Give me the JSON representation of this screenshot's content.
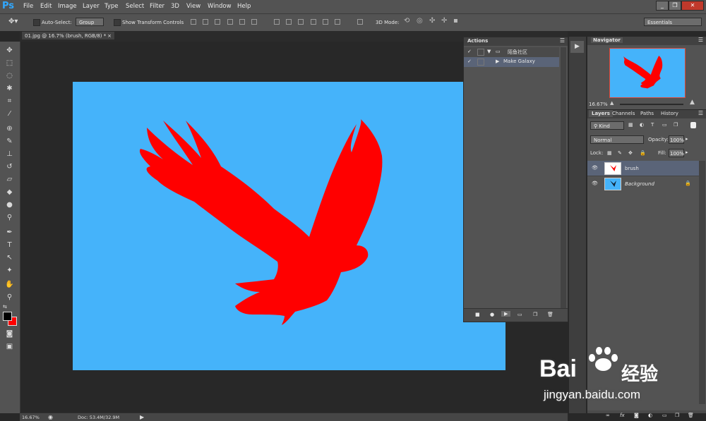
{
  "app": {
    "logo": "Ps"
  },
  "menu": [
    "File",
    "Edit",
    "Image",
    "Layer",
    "Type",
    "Select",
    "Filter",
    "3D",
    "View",
    "Window",
    "Help"
  ],
  "window_buttons": [
    "_",
    "❐",
    "✕"
  ],
  "options": {
    "auto_select_label": "Auto-Select:",
    "auto_select_value": "Group",
    "transform_label": "Show Transform Controls",
    "mode3d_label": "3D Mode:",
    "workspace": "Essentials"
  },
  "document": {
    "tab_title": "01.jpg @ 16.7% (brush, RGB/8) *",
    "tab_close": "×"
  },
  "status": {
    "zoom": "16.67%",
    "doc": "Doc: 53.4M/32.9M"
  },
  "actions_panel": {
    "title": "Actions",
    "items": [
      {
        "label": "陌鱼社区",
        "type": "set"
      },
      {
        "label": "Make Galaxy",
        "type": "action"
      }
    ]
  },
  "navigator": {
    "title": "Navigator",
    "zoom": "16.67%"
  },
  "layers_panel": {
    "tabs": [
      "Layers",
      "Channels",
      "Paths",
      "History"
    ],
    "filter": "Kind",
    "blend_mode": "Normal",
    "opacity_label": "Opacity:",
    "opacity": "100%",
    "lock_label": "Lock:",
    "fill_label": "Fill:",
    "fill": "100%",
    "layers": [
      {
        "name": "brush",
        "selected": true
      },
      {
        "name": "Background",
        "selected": false,
        "locked": true
      }
    ]
  },
  "watermark": {
    "brand": "Bai",
    "brand2": "经验",
    "url": "jingyan.baidu.com"
  },
  "colors": {
    "canvas": "#45b3fa",
    "bird": "#ff0000",
    "foreground": "#000000",
    "background_color": "#ff0000"
  }
}
